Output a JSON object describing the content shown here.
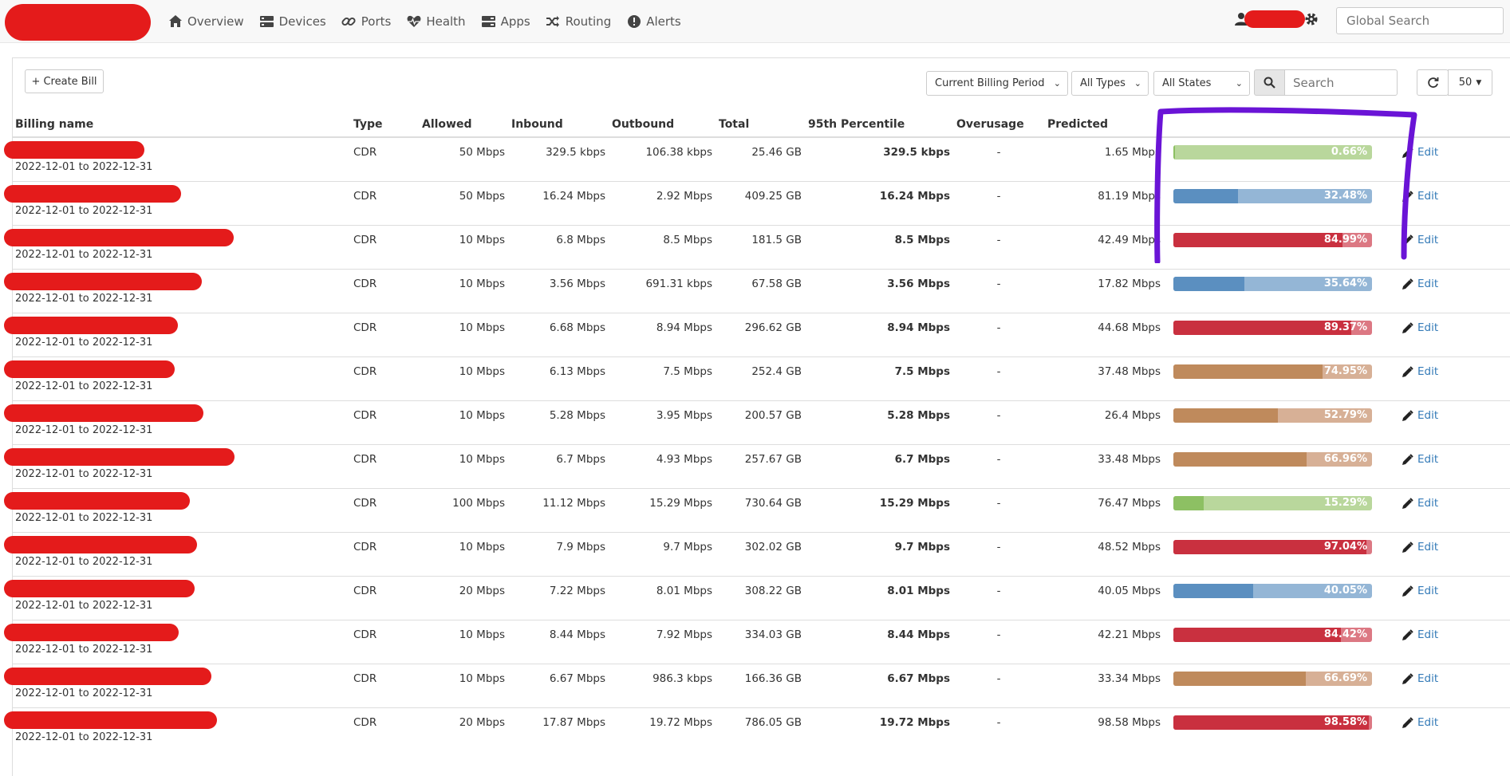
{
  "nav": {
    "items": [
      {
        "label": "Overview",
        "icon": "home-icon"
      },
      {
        "label": "Devices",
        "icon": "server-icon"
      },
      {
        "label": "Ports",
        "icon": "link-icon"
      },
      {
        "label": "Health",
        "icon": "heartbeat-icon"
      },
      {
        "label": "Apps",
        "icon": "tasks-icon"
      },
      {
        "label": "Routing",
        "icon": "random-icon"
      },
      {
        "label": "Alerts",
        "icon": "exclamation-circle-icon"
      }
    ],
    "global_search_placeholder": "Global Search"
  },
  "toolbar": {
    "create_bill_label": "+ Create Bill",
    "period_select": "Current Billing Period",
    "type_select": "All Types",
    "state_select": "All States",
    "search_placeholder": "Search",
    "page_size": "50"
  },
  "table": {
    "headers": [
      "Billing name",
      "Type",
      "Allowed",
      "Inbound",
      "Outbound",
      "Total",
      "95th Percentile",
      "Overusage",
      "Predicted",
      "",
      ""
    ],
    "edit_label": "Edit",
    "rows": [
      {
        "period": "2022-12-01 to 2022-12-31",
        "type": "CDR",
        "allowed": "50 Mbps",
        "inbound": "329.5 kbps",
        "outbound": "106.38 kbps",
        "total": "25.46 GB",
        "p95": "329.5 kbps",
        "overusage": "-",
        "predicted": "1.65 Mbps",
        "pct": "0.66%",
        "pct_value": 0.66,
        "status": "green"
      },
      {
        "period": "2022-12-01 to 2022-12-31",
        "type": "CDR",
        "allowed": "50 Mbps",
        "inbound": "16.24 Mbps",
        "outbound": "2.92 Mbps",
        "total": "409.25 GB",
        "p95": "16.24 Mbps",
        "overusage": "-",
        "predicted": "81.19 Mbps",
        "pct": "32.48%",
        "pct_value": 32.48,
        "status": "blue"
      },
      {
        "period": "2022-12-01 to 2022-12-31",
        "type": "CDR",
        "allowed": "10 Mbps",
        "inbound": "6.8 Mbps",
        "outbound": "8.5 Mbps",
        "total": "181.5 GB",
        "p95": "8.5 Mbps",
        "overusage": "-",
        "predicted": "42.49 Mbps",
        "pct": "84.99%",
        "pct_value": 84.99,
        "status": "red"
      },
      {
        "period": "2022-12-01 to 2022-12-31",
        "type": "CDR",
        "allowed": "10 Mbps",
        "inbound": "3.56 Mbps",
        "outbound": "691.31 kbps",
        "total": "67.58 GB",
        "p95": "3.56 Mbps",
        "overusage": "-",
        "predicted": "17.82 Mbps",
        "pct": "35.64%",
        "pct_value": 35.64,
        "status": "blue"
      },
      {
        "period": "2022-12-01 to 2022-12-31",
        "type": "CDR",
        "allowed": "10 Mbps",
        "inbound": "6.68 Mbps",
        "outbound": "8.94 Mbps",
        "total": "296.62 GB",
        "p95": "8.94 Mbps",
        "overusage": "-",
        "predicted": "44.68 Mbps",
        "pct": "89.37%",
        "pct_value": 89.37,
        "status": "red"
      },
      {
        "period": "2022-12-01 to 2022-12-31",
        "type": "CDR",
        "allowed": "10 Mbps",
        "inbound": "6.13 Mbps",
        "outbound": "7.5 Mbps",
        "total": "252.4 GB",
        "p95": "7.5 Mbps",
        "overusage": "-",
        "predicted": "37.48 Mbps",
        "pct": "74.95%",
        "pct_value": 74.95,
        "status": "orange"
      },
      {
        "period": "2022-12-01 to 2022-12-31",
        "type": "CDR",
        "allowed": "10 Mbps",
        "inbound": "5.28 Mbps",
        "outbound": "3.95 Mbps",
        "total": "200.57 GB",
        "p95": "5.28 Mbps",
        "overusage": "-",
        "predicted": "26.4 Mbps",
        "pct": "52.79%",
        "pct_value": 52.79,
        "status": "orange"
      },
      {
        "period": "2022-12-01 to 2022-12-31",
        "type": "CDR",
        "allowed": "10 Mbps",
        "inbound": "6.7 Mbps",
        "outbound": "4.93 Mbps",
        "total": "257.67 GB",
        "p95": "6.7 Mbps",
        "overusage": "-",
        "predicted": "33.48 Mbps",
        "pct": "66.96%",
        "pct_value": 66.96,
        "status": "orange"
      },
      {
        "period": "2022-12-01 to 2022-12-31",
        "type": "CDR",
        "allowed": "100 Mbps",
        "inbound": "11.12 Mbps",
        "outbound": "15.29 Mbps",
        "total": "730.64 GB",
        "p95": "15.29 Mbps",
        "overusage": "-",
        "predicted": "76.47 Mbps",
        "pct": "15.29%",
        "pct_value": 15.29,
        "status": "green"
      },
      {
        "period": "2022-12-01 to 2022-12-31",
        "type": "CDR",
        "allowed": "10 Mbps",
        "inbound": "7.9 Mbps",
        "outbound": "9.7 Mbps",
        "total": "302.02 GB",
        "p95": "9.7 Mbps",
        "overusage": "-",
        "predicted": "48.52 Mbps",
        "pct": "97.04%",
        "pct_value": 97.04,
        "status": "red"
      },
      {
        "period": "2022-12-01 to 2022-12-31",
        "type": "CDR",
        "allowed": "20 Mbps",
        "inbound": "7.22 Mbps",
        "outbound": "8.01 Mbps",
        "total": "308.22 GB",
        "p95": "8.01 Mbps",
        "overusage": "-",
        "predicted": "40.05 Mbps",
        "pct": "40.05%",
        "pct_value": 40.05,
        "status": "blue"
      },
      {
        "period": "2022-12-01 to 2022-12-31",
        "type": "CDR",
        "allowed": "10 Mbps",
        "inbound": "8.44 Mbps",
        "outbound": "7.92 Mbps",
        "total": "334.03 GB",
        "p95": "8.44 Mbps",
        "overusage": "-",
        "predicted": "42.21 Mbps",
        "pct": "84.42%",
        "pct_value": 84.42,
        "status": "red"
      },
      {
        "period": "2022-12-01 to 2022-12-31",
        "type": "CDR",
        "allowed": "10 Mbps",
        "inbound": "6.67 Mbps",
        "outbound": "986.3 kbps",
        "total": "166.36 GB",
        "p95": "6.67 Mbps",
        "overusage": "-",
        "predicted": "33.34 Mbps",
        "pct": "66.69%",
        "pct_value": 66.69,
        "status": "orange"
      },
      {
        "period": "2022-12-01 to 2022-12-31",
        "type": "CDR",
        "allowed": "20 Mbps",
        "inbound": "17.87 Mbps",
        "outbound": "19.72 Mbps",
        "total": "786.05 GB",
        "p95": "19.72 Mbps",
        "overusage": "-",
        "predicted": "98.58 Mbps",
        "pct": "98.58%",
        "pct_value": 98.58,
        "status": "red"
      }
    ]
  },
  "colors": {
    "green": {
      "dark": "#8dc063",
      "light": "#b9d79c"
    },
    "blue": {
      "dark": "#5b8fc0",
      "light": "#94b6d6"
    },
    "red": {
      "dark": "#c9303f",
      "light": "#dc7883"
    },
    "orange": {
      "dark": "#bf8a5c",
      "light": "#d7b096"
    },
    "redaction": "#e41b1b",
    "annotation": "#6a14d6",
    "link": "#337ab7"
  }
}
